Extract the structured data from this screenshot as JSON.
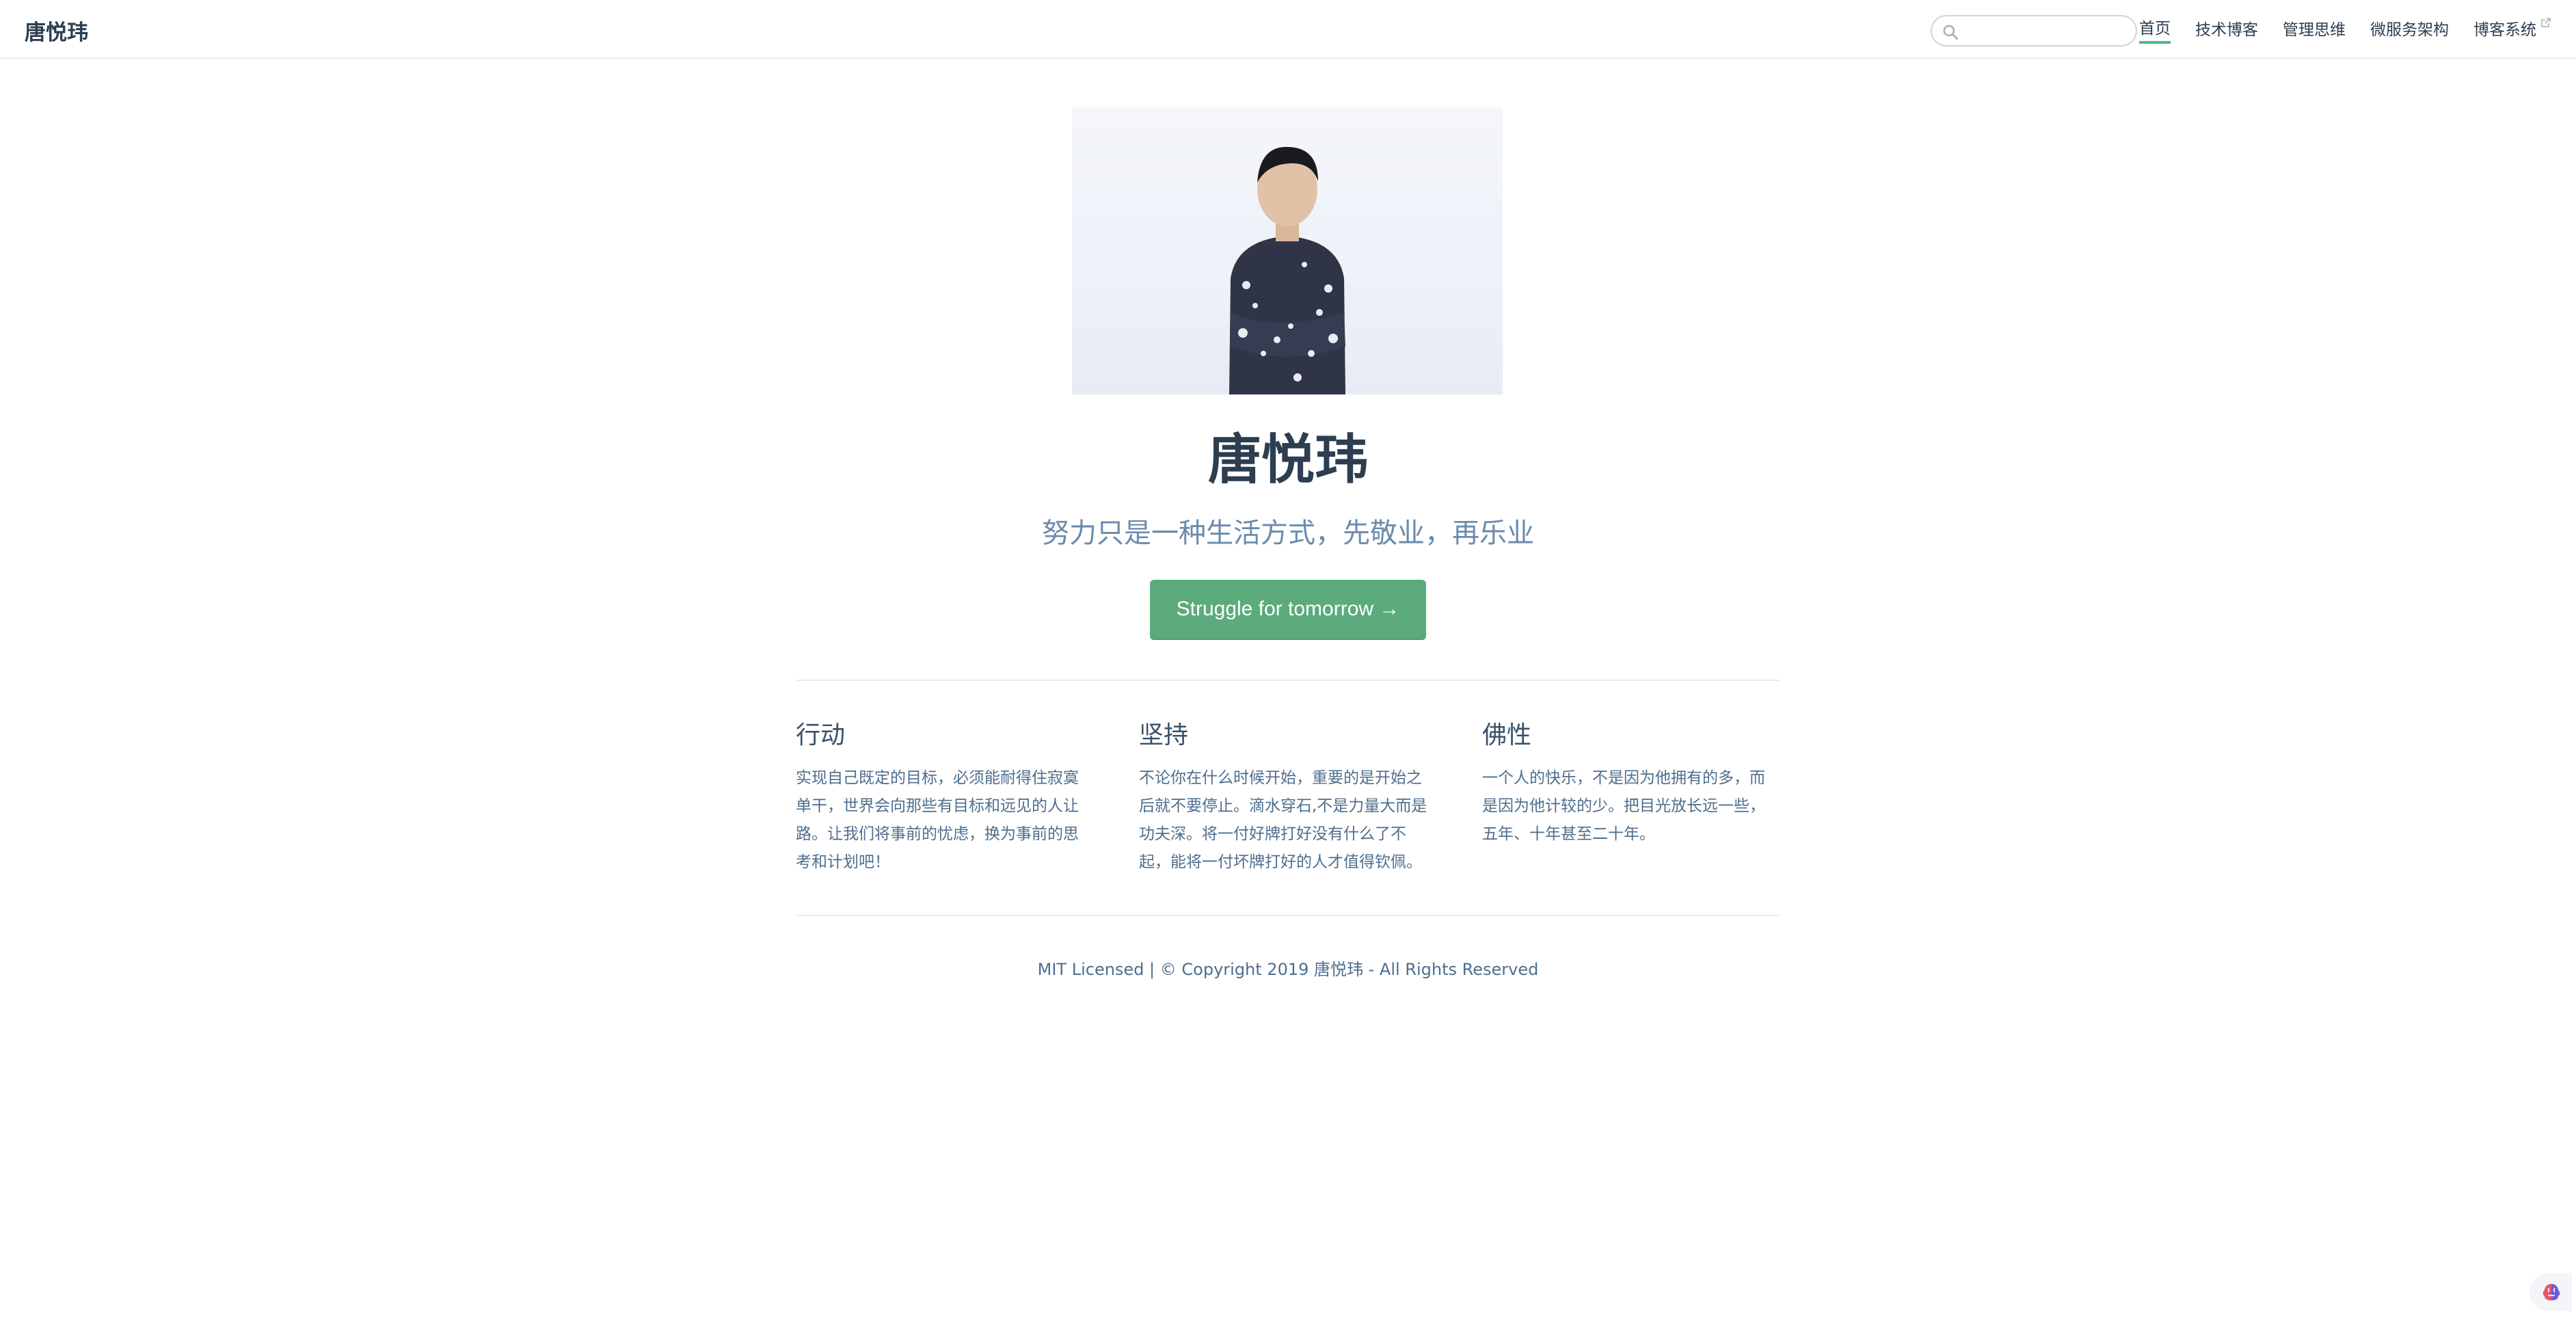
{
  "navbar": {
    "site_name": "唐悦玮",
    "search": {
      "value": "",
      "placeholder": ""
    },
    "links": [
      {
        "label": "首页",
        "active": true
      },
      {
        "label": "技术博客"
      },
      {
        "label": "管理思维"
      },
      {
        "label": "微服务架构"
      },
      {
        "label": "博客系统",
        "external": true
      }
    ]
  },
  "hero": {
    "title": "唐悦玮",
    "description": "努力只是一种生活方式，先敬业，再乐业",
    "action_label": "Struggle for tomorrow →"
  },
  "features": [
    {
      "title": "行动",
      "details": "实现自己既定的目标，必须能耐得住寂寞单干，世界会向那些有目标和远见的人让路。让我们将事前的忧虑，换为事前的思考和计划吧！"
    },
    {
      "title": "坚持",
      "details": "不论你在什么时候开始，重要的是开始之后就不要停止。滴水穿石,不是力量大而是功夫深。将一付好牌打好没有什么了不起，能将一付坏牌打好的人才值得钦佩。"
    },
    {
      "title": "佛性",
      "details": "一个人的快乐，不是因为他拥有的多，而是因为他计较的少。把目光放长远一些，五年、十年甚至二十年。"
    }
  ],
  "footer": {
    "text": "MIT Licensed | © Copyright 2019 唐悦玮 - All Rights Reserved"
  },
  "colors": {
    "accent": "#5cab7d",
    "nav_active_underline": "#46bd87",
    "text": "#2c3e50",
    "muted_text": "#6a8bad"
  },
  "icons": {
    "search": "search-icon",
    "external": "external-link-icon",
    "corner": "brain-icon"
  }
}
